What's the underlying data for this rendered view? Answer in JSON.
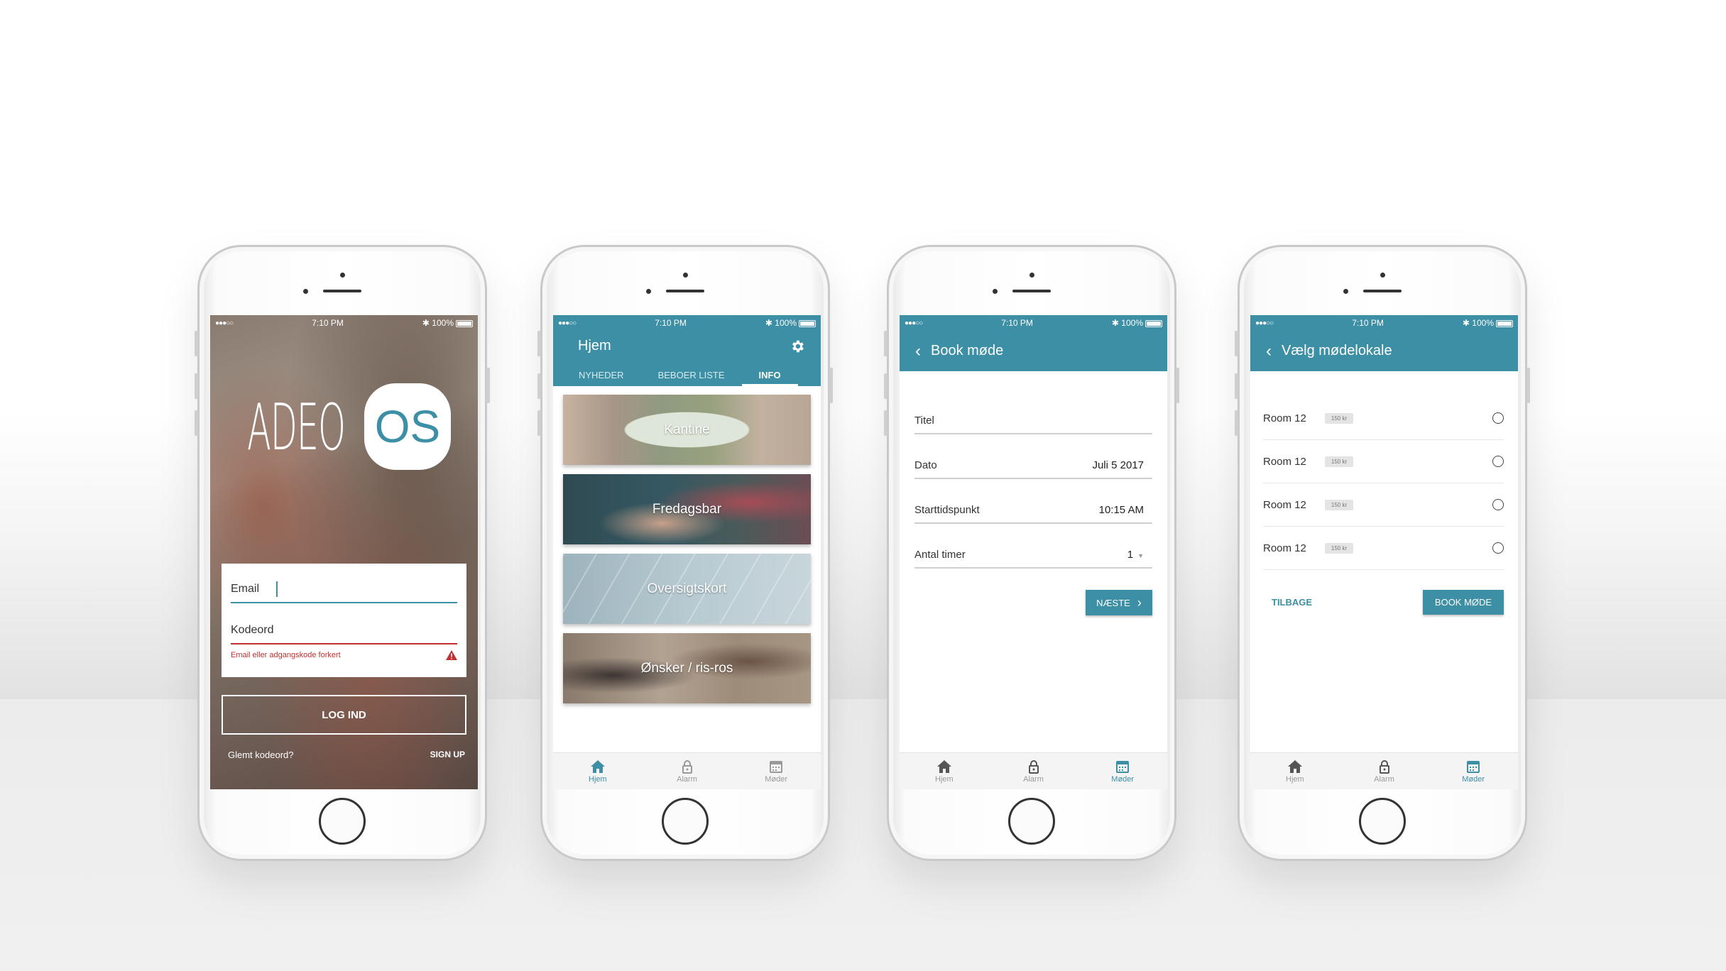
{
  "status": {
    "time": "7:10 PM",
    "battery": "100%",
    "signal": "●●●○○"
  },
  "login": {
    "logo_text": "ADEO",
    "logo_badge": "OS",
    "email_label": "Email",
    "password_label": "Kodeord",
    "error_message": "Email eller adgangskode forkert",
    "login_button": "LOG IND",
    "forgot_link": "Glemt kodeord?",
    "signup_link": "SIGN UP"
  },
  "home": {
    "title": "Hjem",
    "tabs": [
      "NYHEDER",
      "BEBOER LISTE",
      "INFO"
    ],
    "cards": [
      "Kantine",
      "Fredagsbar",
      "Oversigtskort",
      "Ønsker / ris-ros"
    ]
  },
  "book": {
    "title": "Book møde",
    "fields": [
      {
        "label": "Titel",
        "value": ""
      },
      {
        "label": "Dato",
        "value": "Juli 5 2017"
      },
      {
        "label": "Starttidspunkt",
        "value": "10:15 AM"
      },
      {
        "label": "Antal timer",
        "value": "1"
      }
    ],
    "next_button": "NÆSTE"
  },
  "rooms": {
    "title": "Vælg mødelokale",
    "items": [
      {
        "name": "Room 12",
        "price": "150 kr"
      },
      {
        "name": "Room 12",
        "price": "150 kr"
      },
      {
        "name": "Room 12",
        "price": "150 kr"
      },
      {
        "name": "Room 12",
        "price": "150 kr"
      }
    ],
    "back_link": "TILBAGE",
    "book_button": "BOOK MØDE"
  },
  "tabbar": {
    "home": "Hjem",
    "alarm": "Alarm",
    "meetings": "Møder"
  },
  "colors": {
    "accent": "#3c8fa4",
    "error": "#c03030"
  }
}
